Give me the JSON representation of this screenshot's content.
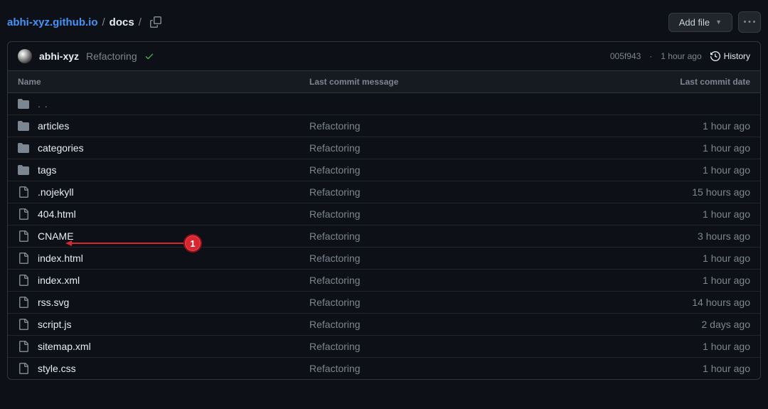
{
  "breadcrumb": {
    "repo": "abhi-xyz.github.io",
    "sep": "/",
    "current": "docs",
    "trailing": "/"
  },
  "actions": {
    "add_file": "Add file"
  },
  "commit": {
    "author": "abhi-xyz",
    "message": "Refactoring",
    "sha": "005f943",
    "sep": "·",
    "time": "1 hour ago",
    "history_label": "History"
  },
  "table": {
    "col_name": "Name",
    "col_msg": "Last commit message",
    "col_date": "Last commit date",
    "parent": ". ."
  },
  "rows": [
    {
      "type": "dir",
      "name": "articles",
      "msg": "Refactoring",
      "date": "1 hour ago"
    },
    {
      "type": "dir",
      "name": "categories",
      "msg": "Refactoring",
      "date": "1 hour ago"
    },
    {
      "type": "dir",
      "name": "tags",
      "msg": "Refactoring",
      "date": "1 hour ago"
    },
    {
      "type": "file",
      "name": ".nojekyll",
      "msg": "Refactoring",
      "date": "15 hours ago"
    },
    {
      "type": "file",
      "name": "404.html",
      "msg": "Refactoring",
      "date": "1 hour ago"
    },
    {
      "type": "file",
      "name": "CNAME",
      "msg": "Refactoring",
      "date": "3 hours ago"
    },
    {
      "type": "file",
      "name": "index.html",
      "msg": "Refactoring",
      "date": "1 hour ago"
    },
    {
      "type": "file",
      "name": "index.xml",
      "msg": "Refactoring",
      "date": "1 hour ago"
    },
    {
      "type": "file",
      "name": "rss.svg",
      "msg": "Refactoring",
      "date": "14 hours ago"
    },
    {
      "type": "file",
      "name": "script.js",
      "msg": "Refactoring",
      "date": "2 days ago"
    },
    {
      "type": "file",
      "name": "sitemap.xml",
      "msg": "Refactoring",
      "date": "1 hour ago"
    },
    {
      "type": "file",
      "name": "style.css",
      "msg": "Refactoring",
      "date": "1 hour ago"
    }
  ],
  "annotation": {
    "label": "1"
  }
}
